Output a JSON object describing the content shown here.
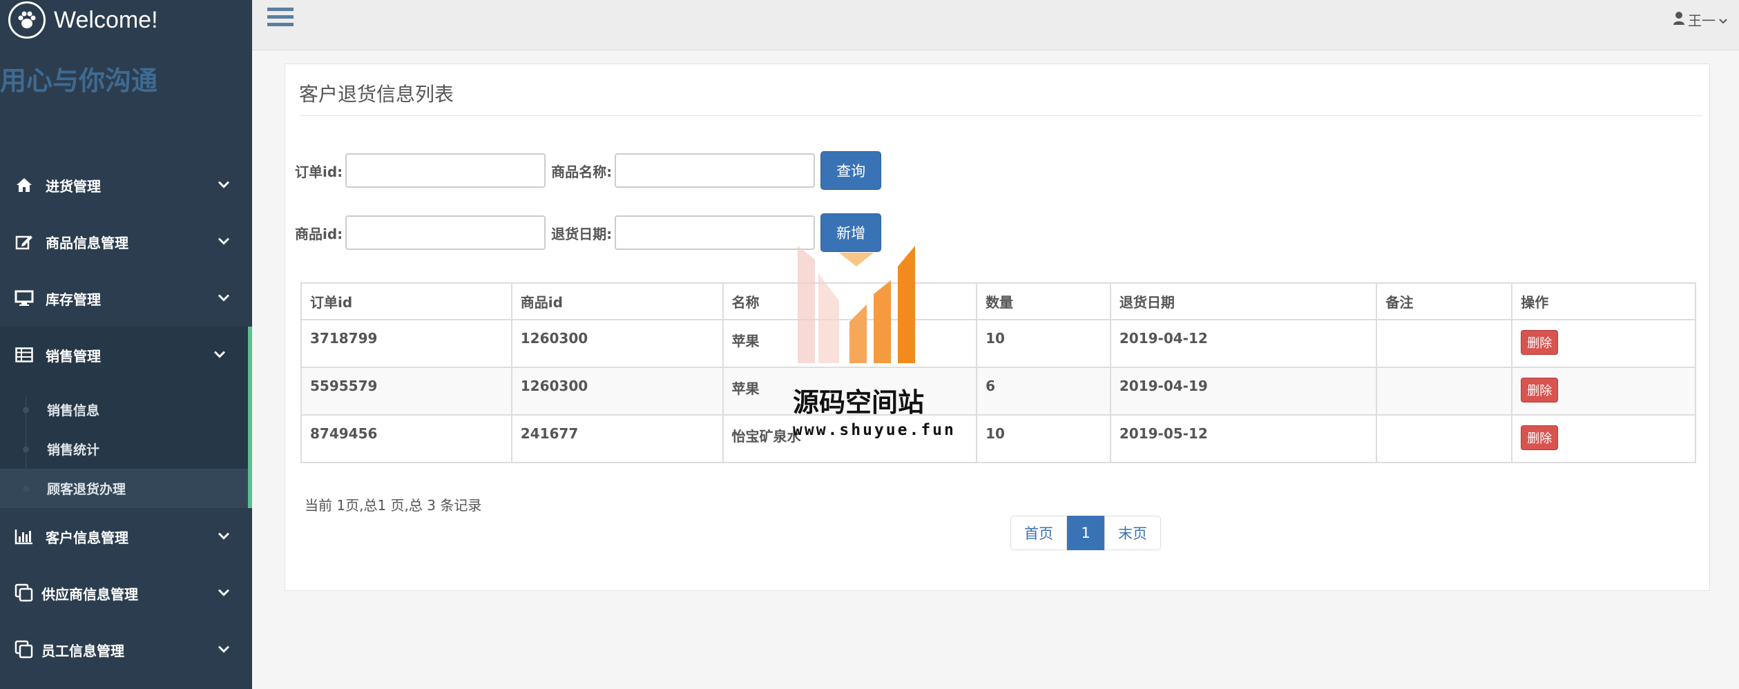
{
  "brand": {
    "title": "Welcome!",
    "slogan": "用心与你沟通"
  },
  "sidebar": {
    "items": [
      {
        "label": "进货管理",
        "icon": "home-icon"
      },
      {
        "label": "商品信息管理",
        "icon": "edit-icon"
      },
      {
        "label": "库存管理",
        "icon": "monitor-icon"
      },
      {
        "label": "销售管理",
        "icon": "table-icon",
        "active": true
      },
      {
        "label": "客户信息管理",
        "icon": "bar-chart-icon"
      },
      {
        "label": "供应商信息管理",
        "icon": "copy-icon"
      },
      {
        "label": "员工信息管理",
        "icon": "copy-icon"
      }
    ],
    "submenu": [
      {
        "label": "销售信息"
      },
      {
        "label": "销售统计"
      },
      {
        "label": "顾客退货办理"
      }
    ]
  },
  "topbar": {
    "user": "王一"
  },
  "panel": {
    "title": "客户退货信息列表"
  },
  "search": {
    "order_id_label": "订单id:",
    "product_name_label": "商品名称:",
    "query_button": "查询",
    "product_id_label": "商品id:",
    "return_date_label": "退货日期:",
    "add_button": "新增"
  },
  "table": {
    "headers": [
      "订单id",
      "商品id",
      "名称",
      "数量",
      "退货日期",
      "备注",
      "操作"
    ],
    "rows": [
      {
        "order_id": "3718799",
        "product_id": "1260300",
        "name": "苹果",
        "qty": "10",
        "date": "2019-04-12",
        "note": "",
        "action": "删除"
      },
      {
        "order_id": "5595579",
        "product_id": "1260300",
        "name": "苹果",
        "qty": "6",
        "date": "2019-04-19",
        "note": "",
        "action": "删除"
      },
      {
        "order_id": "8749456",
        "product_id": "241677",
        "name": "怡宝矿泉水",
        "qty": "10",
        "date": "2019-05-12",
        "note": "",
        "action": "删除"
      }
    ]
  },
  "pagination": {
    "summary": "当前 1页,总1 页,总 3 条记录",
    "first": "首页",
    "current": "1",
    "last": "末页"
  },
  "watermark": {
    "text": "源码空间站",
    "url": "www.shuyue.fun"
  },
  "colors": {
    "sidebar": "#2b3d4f",
    "accent": "#5cc08f",
    "primary": "#3a73b5",
    "danger": "#d9534f"
  }
}
